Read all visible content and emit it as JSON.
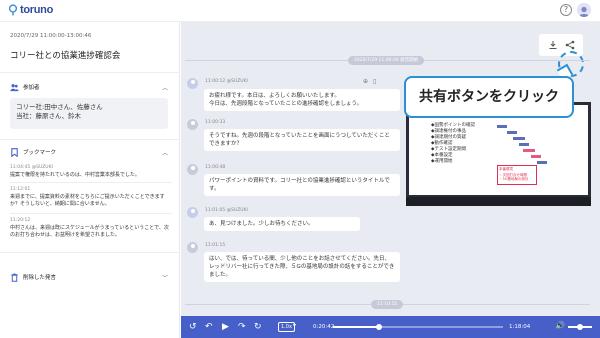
{
  "app": {
    "logo": "toruno",
    "help_label": "?"
  },
  "meeting": {
    "datetime": "2020/7/29 11:00:00-13:00:46",
    "title": "コリー社との協業進捗確認会"
  },
  "sidebar": {
    "participants_label": "参加者",
    "participants": [
      "コリー社:田中さん、佐藤さん",
      "当社：藤原さん、鈴木"
    ],
    "bookmark_label": "ブックマーク",
    "bookmarks": [
      {
        "time": "11:04:45 @SUZUKI",
        "text": "提案で権限を持たれているのは、中村営業本部長でした。"
      },
      {
        "time": "11:12:01",
        "text": "来週までに、提案資料の素材をこちらにご提示いただくことできますか？そうしないと、納期に間に合いません。"
      },
      {
        "time": "11:20:12",
        "text": "中村さんは、来週は既にスケジュールがうまっているということで、次のお打ち合わせは、お盆明けを希望されました。"
      }
    ],
    "deleted_label": "削除した発言"
  },
  "transcript": {
    "date_label": "2020/7/29 11:00:00 録音開始",
    "messages": [
      {
        "time": "11:00:12 @SUZUKI",
        "text": "お疲れ様です。本日は、よろしくお願いいたします。\n今日は、先週段階となっていたことの進捗確認をしましょう。"
      },
      {
        "time": "11:00:33",
        "text": "そうですね。先週の段階となっていたことを画面にうつしていただくことできますか？"
      },
      {
        "time": "11:00:48",
        "text": "パワーポイントの資料です。コリー社との協業進捗確認というタイトルです。"
      },
      {
        "time": "11:01:05 @SUZUKI",
        "text": "あ、見つけました。少しお待ちください。"
      },
      {
        "time": "11:01:15",
        "text": "はい、では、待っている間、少し他のことをお話させてください。先日、レッドリバー社に行ってきた際、５Gの基地局の設計の話をすることができました。"
      }
    ],
    "bottom_time": "11:10:55"
  },
  "callout": {
    "text": "共有ボタンをクリック"
  },
  "slide": {
    "bullets": [
      "◆国勢ポイントの確認",
      "◆調達権付の事品",
      "◆調達期付の質疑",
      "◆動作確認",
      "◆テスト設定期間",
      "◆本番設定",
      "◆運用開始"
    ],
    "note_title": "本番環境",
    "note_lines": [
      "・次回打合せ時間",
      "・5G基地局の設計"
    ]
  },
  "player": {
    "speed": "1.0x",
    "current_time": "0:20:42",
    "duration": "1:18:04",
    "progress": 0.27
  },
  "colors": {
    "accent": "#4760c9",
    "highlight": "#2d8fd4",
    "logo": "#2f4a9e"
  }
}
